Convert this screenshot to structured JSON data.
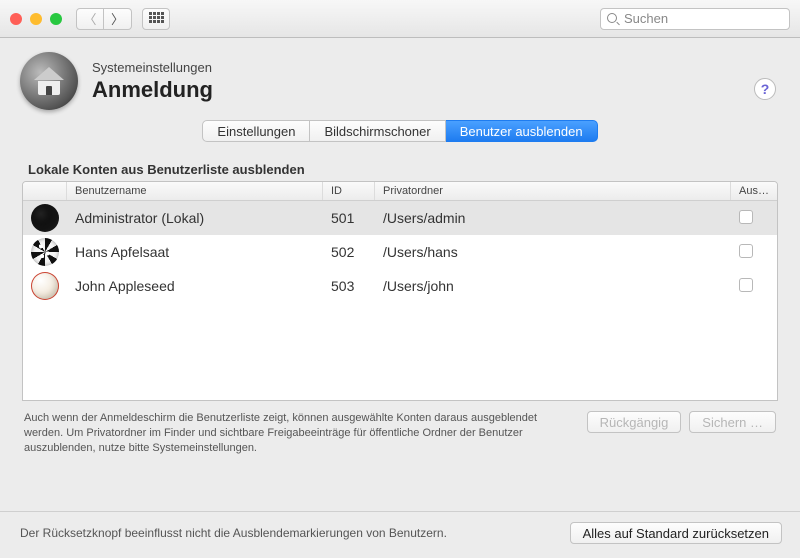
{
  "window": {
    "traffic": {
      "close": "#ff5f57",
      "min": "#febc2e",
      "max": "#28c840"
    },
    "search_placeholder": "Suchen"
  },
  "header": {
    "breadcrumb": "Systemeinstellungen",
    "title": "Anmeldung"
  },
  "tabs": [
    {
      "label": "Einstellungen",
      "active": false
    },
    {
      "label": "Bildschirmschoner",
      "active": false
    },
    {
      "label": "Benutzer ausblenden",
      "active": true
    }
  ],
  "section": {
    "label": "Lokale Konten aus Benutzerliste ausblenden",
    "columns": {
      "name": "Benutzername",
      "id": "ID",
      "home": "Privatordner",
      "hide": "Aus…"
    },
    "rows": [
      {
        "name": "Administrator (Lokal)",
        "id": "501",
        "home": "/Users/admin",
        "selected": true,
        "icon_css": "background: radial-gradient(circle at 35% 35%, #222, #000 65%); box-shadow: inset -4px -4px 8px rgba(255,255,255,.1);"
      },
      {
        "name": "Hans Apfelsaat",
        "id": "502",
        "home": "/Users/hans",
        "selected": false,
        "icon_css": "background: radial-gradient(circle at 35% 30%, #fff 0 2px, transparent 2px), radial-gradient(circle at 60% 55%, #fff 0 2px, transparent 2px), radial-gradient(circle at 40% 65%, #fff 0 2px, transparent 2px), repeating-conic-gradient(#111 0 30deg,#f5f5f5 30deg 60deg); box-shadow: inset 0 0 4px rgba(0,0,0,.4);"
      },
      {
        "name": "John Appleseed",
        "id": "503",
        "home": "/Users/john",
        "selected": false,
        "icon_css": "background: radial-gradient(circle at 35% 30%, #fff, #f2e9db 55%, #e6d9c0); box-shadow: inset 0 0 0 1px #cc4433, inset -3px -3px 6px rgba(0,0,0,.15);"
      }
    ],
    "note": "Auch wenn der Anmeldeschirm die Benutzerliste zeigt, können ausgewählte Konten daraus ausgeblendet werden. Um Privatordner im Finder und sichtbare Freigabeeinträge für öffentliche Ordner der Benutzer auszublenden, nutze bitte Systemeinstellungen.",
    "buttons": {
      "revert": "Rückgängig",
      "save": "Sichern …"
    }
  },
  "footer": {
    "note": "Der Rücksetzknopf beeinflusst nicht die Ausblendemarkierungen von Benutzern.",
    "reset": "Alles auf Standard zurücksetzen"
  }
}
